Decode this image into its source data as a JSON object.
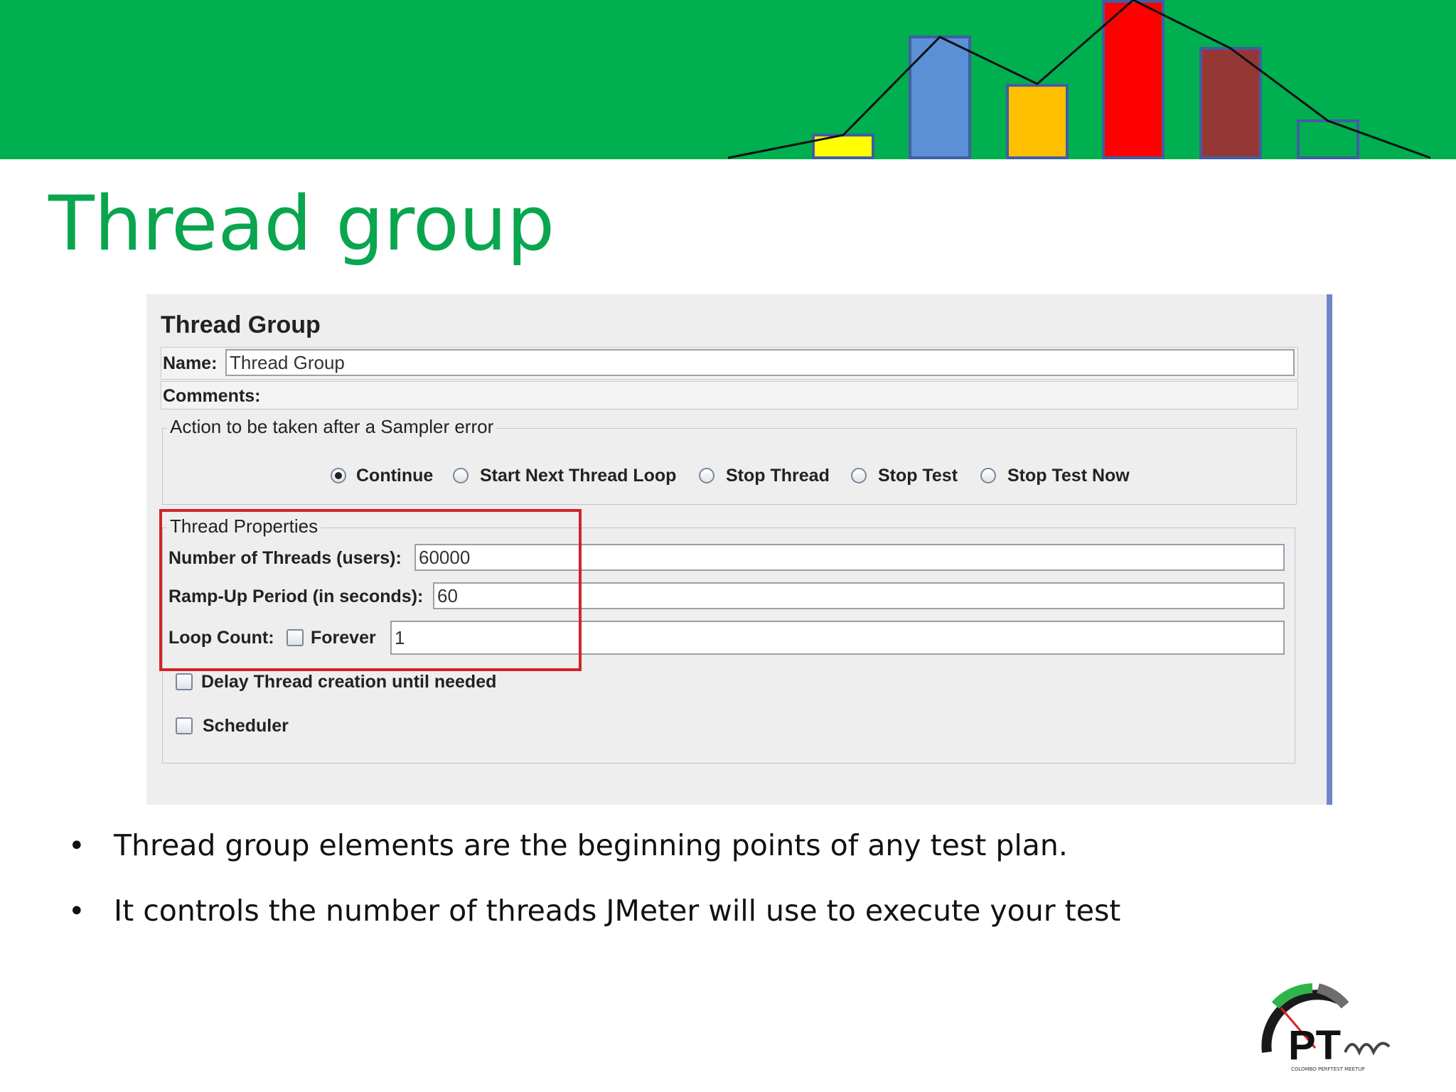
{
  "slide": {
    "title": "Thread group",
    "bullets": [
      "Thread group elements are the beginning points of any test plan.",
      "It controls the number of threads JMeter will use to execute your test"
    ],
    "colors": {
      "banner": "#00af50",
      "title": "#0aa54f",
      "highlight": "#d2232a"
    }
  },
  "banner_bars": {
    "colors": [
      "#ffff00",
      "#5b8fd6",
      "#ffc000",
      "#ff0000",
      "#953735",
      "#00af50"
    ]
  },
  "window": {
    "title": "Thread Group",
    "name_label": "Name:",
    "name_value": "Thread Group",
    "comments_label": "Comments:",
    "sampler_error": {
      "legend": "Action to be taken after a Sampler error",
      "options": [
        "Continue",
        "Start Next Thread Loop",
        "Stop Thread",
        "Stop Test",
        "Stop Test Now"
      ],
      "selected": "Continue"
    },
    "thread_properties": {
      "legend": "Thread Properties",
      "threads_label": "Number of Threads (users):",
      "threads_value": "60000",
      "rampup_label": "Ramp-Up Period (in seconds):",
      "rampup_value": "60",
      "loop_label": "Loop Count:",
      "forever_label": "Forever",
      "forever_checked": false,
      "loop_value": "1",
      "delay_label": "Delay Thread creation until needed",
      "delay_checked": false,
      "scheduler_label": "Scheduler",
      "scheduler_checked": false
    }
  },
  "logo": {
    "text": "PT",
    "subtext": "COLOMBO PERFTEST MEETUP"
  }
}
